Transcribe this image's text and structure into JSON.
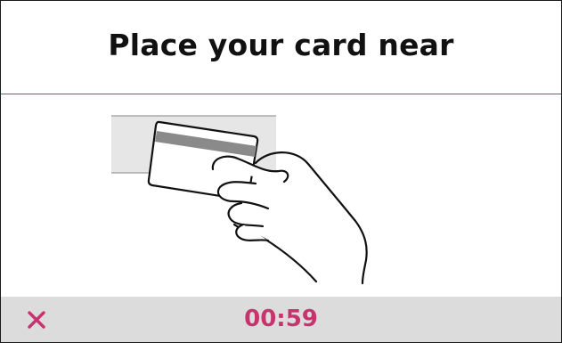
{
  "header": {
    "title": "Place your card near"
  },
  "illustration": {
    "icon": "hand-holding-card-icon"
  },
  "footer": {
    "cancel_icon": "close-icon",
    "timer_text": "00:59"
  },
  "colors": {
    "accent": "#c8336e",
    "footer_bg": "#dcdcdc",
    "reader_bg": "#e6e6e6",
    "card_stripe": "#8a8a8a",
    "text": "#111111"
  }
}
